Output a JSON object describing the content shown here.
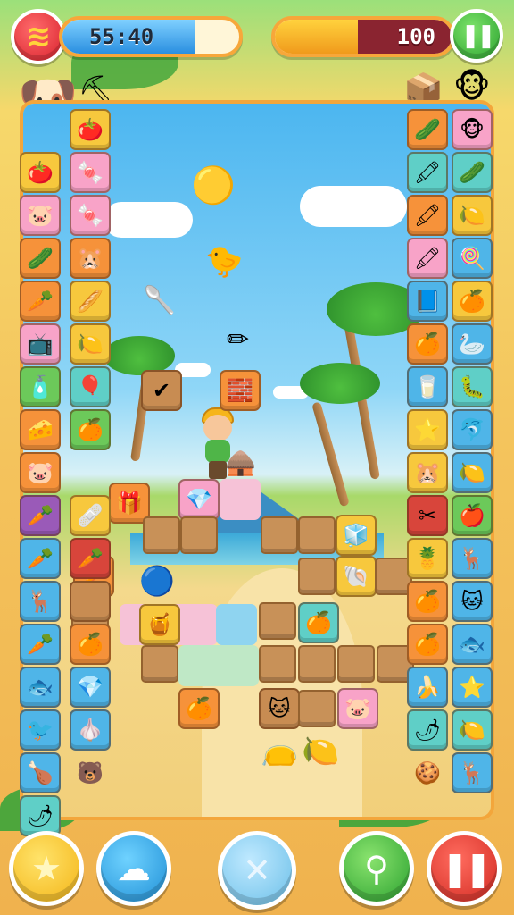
{
  "hud": {
    "timer_text": "55:40",
    "timer_fill": 0.75,
    "score_text": "100",
    "score_fill": 0.47
  },
  "icons": {
    "logo": "swirl-logo-icon",
    "pause_top": "pause-icon",
    "star": "star-icon",
    "cloud": "cloud-icon",
    "close": "close-icon",
    "search": "search-icon",
    "pause_bottom": "pause-icon"
  },
  "glyphs": {
    "pause": "❚❚",
    "star": "★",
    "cloud": "☁",
    "close": "✕",
    "search": "⚲",
    "logo": "≋"
  },
  "colors": {
    "frame": "#f3a63b",
    "sky": "#4cb6f0",
    "sand": "#f4d98c"
  }
}
